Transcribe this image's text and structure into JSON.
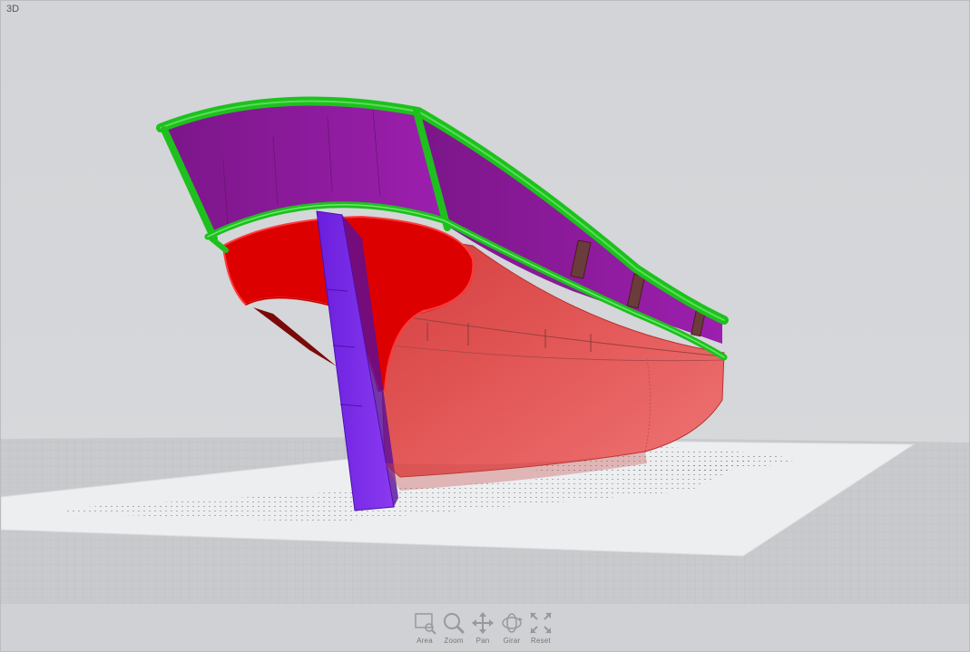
{
  "viewport": {
    "label": "3D"
  },
  "toolbar": {
    "buttons": [
      {
        "id": "area",
        "label": "Area",
        "icon": "zoom-area-icon"
      },
      {
        "id": "zoom",
        "label": "Zoom",
        "icon": "zoom-icon"
      },
      {
        "id": "pan",
        "label": "Pan",
        "icon": "pan-icon"
      },
      {
        "id": "girar",
        "label": "Girar",
        "icon": "rotate-icon"
      },
      {
        "id": "reset",
        "label": "Reset",
        "icon": "reset-view-icon"
      }
    ]
  },
  "colors": {
    "background": "#d3d5d8",
    "hull": "#e25050",
    "transom": "#dd0000",
    "bulwark": "#8b1a9a",
    "rail": "#22cc22",
    "sternpost": "#7a22e8",
    "plan_sheet": "#eceef0"
  }
}
